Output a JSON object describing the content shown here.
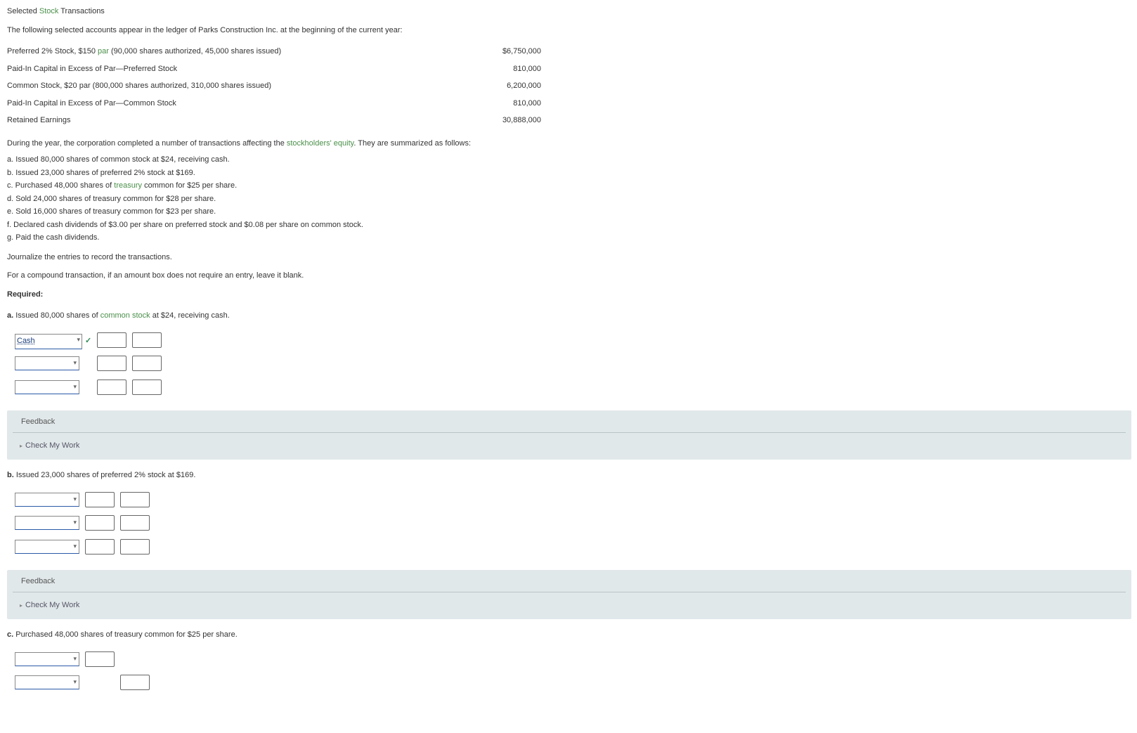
{
  "title_pre": "Selected ",
  "title_green": "Stock",
  "title_post": " Transactions",
  "intro": "The following selected accounts appear in the ledger of Parks Construction Inc. at the beginning of the current year:",
  "ledger": [
    {
      "acct_pre": "Preferred 2% Stock, $150 ",
      "acct_link": "par",
      "acct_post": " (90,000 shares authorized, 45,000 shares issued)",
      "amount": "$6,750,000"
    },
    {
      "acct_pre": "Paid-In Capital in Excess of Par—Preferred Stock",
      "acct_link": "",
      "acct_post": "",
      "amount": "810,000"
    },
    {
      "acct_pre": "Common Stock, $20 par (800,000 shares authorized, 310,000 shares issued)",
      "acct_link": "",
      "acct_post": "",
      "amount": "6,200,000"
    },
    {
      "acct_pre": "Paid-In Capital in Excess of Par—Common Stock",
      "acct_link": "",
      "acct_post": "",
      "amount": "810,000"
    },
    {
      "acct_pre": "Retained Earnings",
      "acct_link": "",
      "acct_post": "",
      "amount": "30,888,000"
    }
  ],
  "during_pre": "During the year, the corporation completed a number of transactions affecting the ",
  "during_link": "stockholders' equity",
  "during_post": ". They are summarized as follows:",
  "items": [
    {
      "pre": "a. Issued 80,000 shares of common stock at $24, receiving cash.",
      "link": "",
      "post": ""
    },
    {
      "pre": "b. Issued 23,000 shares of preferred 2% stock at $169.",
      "link": "",
      "post": ""
    },
    {
      "pre": "c. Purchased 48,000 shares of ",
      "link": "treasury",
      "post": " common for $25 per share."
    },
    {
      "pre": "d. Sold 24,000 shares of treasury common for $28 per share.",
      "link": "",
      "post": ""
    },
    {
      "pre": "e. Sold 16,000 shares of treasury common for $23 per share.",
      "link": "",
      "post": ""
    },
    {
      "pre": "f. Declared cash dividends of $3.00 per share on preferred stock and $0.08 per share on common stock.",
      "link": "",
      "post": ""
    },
    {
      "pre": "g. Paid the cash dividends.",
      "link": "",
      "post": ""
    }
  ],
  "journalize": "Journalize the entries to record the transactions.",
  "compound": "For a compound transaction, if an amount box does not require an entry, leave it blank.",
  "required": "Required:",
  "section_a": {
    "label": "a.",
    "pre": " Issued 80,000 shares of ",
    "link": "common stock",
    "post": " at $24, receiving cash."
  },
  "section_b": {
    "label": "b.",
    "text": " Issued 23,000 shares of preferred 2% stock at $169."
  },
  "section_c": {
    "label": "c.",
    "text": " Purchased 48,000 shares of treasury common for $25 per share."
  },
  "cash_label": "Cash",
  "feedback_label": "Feedback",
  "check_my_work": "Check My Work",
  "dropdown_arrow": "▾",
  "checkmark": "✓",
  "triangle": "▸"
}
